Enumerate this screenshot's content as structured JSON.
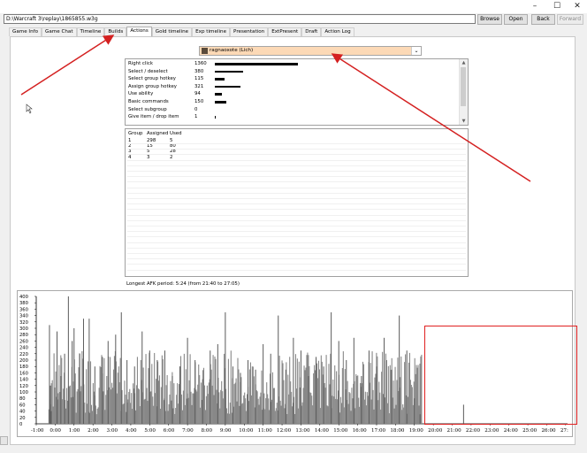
{
  "window": {
    "controls": [
      "–",
      "☐",
      "✕"
    ]
  },
  "toolbar": {
    "path": "D:\\Warcraft 3\\replay\\1865855.w3g",
    "browse": "Browse",
    "open": "Open",
    "back": "Back",
    "forward": "Forward"
  },
  "tabs": [
    "Game Info",
    "Game Chat",
    "Timeline",
    "Builds",
    "Actions",
    "Gold timeline",
    "Exp timeline",
    "Presentation",
    "ExtPresent",
    "Draft",
    "Action Log"
  ],
  "active_tab": "Actions",
  "player_select": {
    "value": "ragnaoxote (Lich)",
    "arrow": "⌄",
    "icon": "hero-portrait-icon"
  },
  "actions": [
    {
      "name": "Right click",
      "value": "1360"
    },
    {
      "name": "Select / deselect",
      "value": "380"
    },
    {
      "name": "Select group hotkey",
      "value": "115"
    },
    {
      "name": "Assign group hotkey",
      "value": "321"
    },
    {
      "name": "Use ability",
      "value": "94"
    },
    {
      "name": "Basic commands",
      "value": "150"
    },
    {
      "name": "Select subgroup",
      "value": "0"
    },
    {
      "name": "Give item / drop item",
      "value": "1"
    }
  ],
  "groups": {
    "headers": [
      "Group",
      "Assigned",
      "Used"
    ],
    "rows": [
      [
        "1",
        "298",
        "5"
      ],
      [
        "2",
        "15",
        "80"
      ],
      [
        "3",
        "5",
        "28"
      ],
      [
        "4",
        "3",
        "2"
      ]
    ]
  },
  "afk_text": "Longest AFK period: 5:24 (from 21:40 to 27:05)",
  "chart_data": {
    "type": "bar",
    "color": "#888888",
    "y_ticks": [
      "400",
      "380",
      "360",
      "340",
      "320",
      "300",
      "280",
      "260",
      "240",
      "220",
      "200",
      "180",
      "160",
      "140",
      "120",
      "100",
      "80",
      "60",
      "40",
      "20",
      "0"
    ],
    "x_ticks": [
      "-1:00",
      "0:00",
      "1:00",
      "2:00",
      "3:00",
      "4:00",
      "5:00",
      "6:00",
      "7:00",
      "8:00",
      "9:00",
      "10:00",
      "11:00",
      "12:00",
      "13:00",
      "14:00",
      "15:00",
      "16:00",
      "17:00",
      "18:00",
      "19:00",
      "20:00",
      "21:00",
      "22:00",
      "23:00",
      "24:00",
      "25:00",
      "26:00",
      "27:"
    ],
    "ylim": [
      0,
      400
    ],
    "xlim": [
      -1,
      27.1
    ],
    "values": [
      {
        "t": -0.3,
        "v": 310
      },
      {
        "t": -0.25,
        "v": 120
      },
      {
        "t": -0.2,
        "v": 40
      },
      {
        "t": 0.1,
        "v": 290
      },
      {
        "t": 0.3,
        "v": 150
      },
      {
        "t": 0.5,
        "v": 220
      },
      {
        "t": 0.7,
        "v": 400
      },
      {
        "t": 0.9,
        "v": 260
      },
      {
        "t": 1.0,
        "v": 300
      },
      {
        "t": 1.3,
        "v": 220
      },
      {
        "t": 1.5,
        "v": 330
      },
      {
        "t": 1.8,
        "v": 330
      },
      {
        "t": 2.1,
        "v": 180
      },
      {
        "t": 2.5,
        "v": 210
      },
      {
        "t": 2.8,
        "v": 260
      },
      {
        "t": 3.2,
        "v": 280
      },
      {
        "t": 3.5,
        "v": 350
      },
      {
        "t": 3.8,
        "v": 200
      },
      {
        "t": 4.2,
        "v": 180
      },
      {
        "t": 4.6,
        "v": 290
      },
      {
        "t": 5.0,
        "v": 230
      },
      {
        "t": 5.4,
        "v": 200
      },
      {
        "t": 5.8,
        "v": 230
      },
      {
        "t": 6.2,
        "v": 150
      },
      {
        "t": 6.6,
        "v": 180
      },
      {
        "t": 7.0,
        "v": 270
      },
      {
        "t": 7.4,
        "v": 200
      },
      {
        "t": 7.8,
        "v": 140
      },
      {
        "t": 8.2,
        "v": 230
      },
      {
        "t": 8.6,
        "v": 250
      },
      {
        "t": 9.0,
        "v": 350
      },
      {
        "t": 9.4,
        "v": 180
      },
      {
        "t": 9.8,
        "v": 160
      },
      {
        "t": 10.2,
        "v": 200
      },
      {
        "t": 10.6,
        "v": 170
      },
      {
        "t": 11.0,
        "v": 250
      },
      {
        "t": 11.4,
        "v": 220
      },
      {
        "t": 11.8,
        "v": 340
      },
      {
        "t": 12.2,
        "v": 170
      },
      {
        "t": 12.6,
        "v": 270
      },
      {
        "t": 13.0,
        "v": 230
      },
      {
        "t": 13.4,
        "v": 150
      },
      {
        "t": 13.8,
        "v": 210
      },
      {
        "t": 14.2,
        "v": 180
      },
      {
        "t": 14.6,
        "v": 350
      },
      {
        "t": 15.0,
        "v": 260
      },
      {
        "t": 15.4,
        "v": 200
      },
      {
        "t": 15.8,
        "v": 270
      },
      {
        "t": 16.2,
        "v": 150
      },
      {
        "t": 16.6,
        "v": 230
      },
      {
        "t": 17.0,
        "v": 180
      },
      {
        "t": 17.4,
        "v": 270
      },
      {
        "t": 17.8,
        "v": 170
      },
      {
        "t": 18.2,
        "v": 340
      },
      {
        "t": 18.6,
        "v": 230
      },
      {
        "t": 19.0,
        "v": 80
      },
      {
        "t": 19.3,
        "v": 30
      },
      {
        "t": 21.6,
        "v": 60
      }
    ]
  },
  "annotations": {
    "arrows": 2,
    "highlight_box": true
  }
}
